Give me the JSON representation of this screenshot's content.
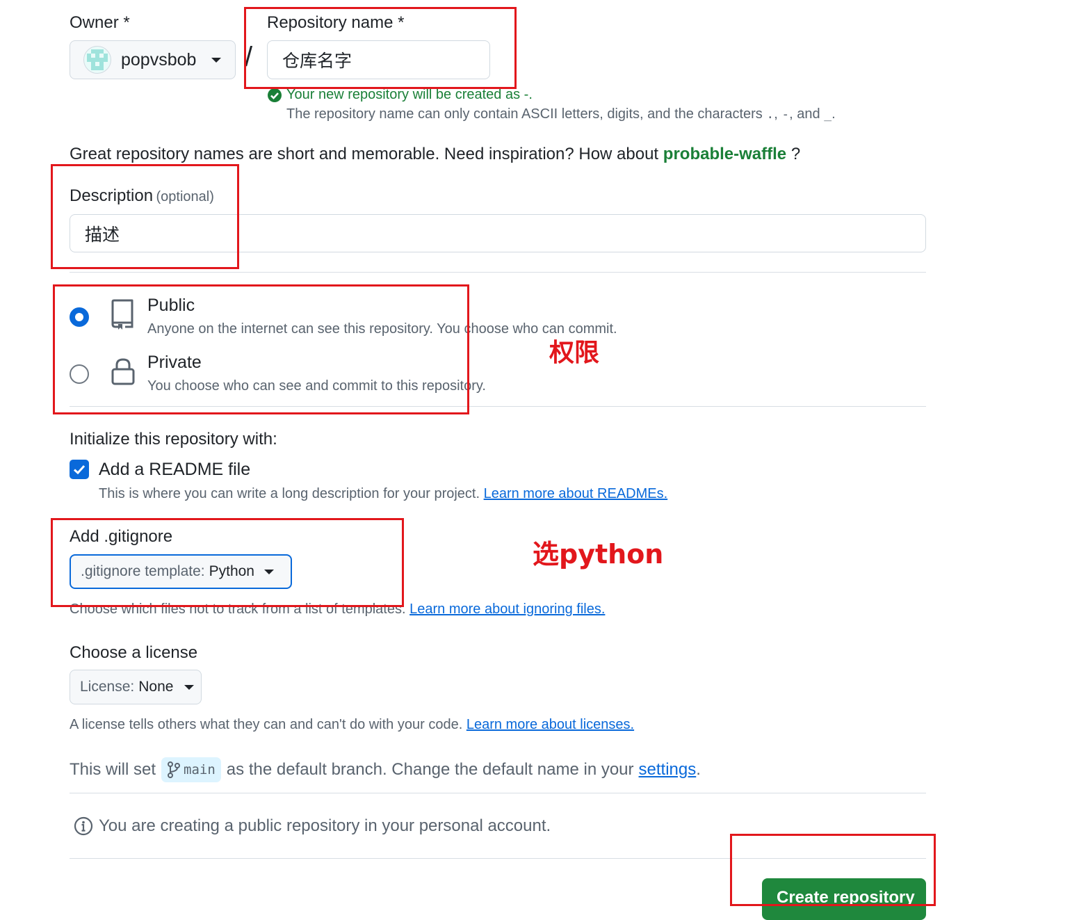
{
  "owner": {
    "label": "Owner *",
    "value": "popvsbob",
    "avatar_icon": "identicon-avatar"
  },
  "separator": "/",
  "repo_name": {
    "label": "Repository name *",
    "value": "仓库名字",
    "success_message": "Your new repository will be created as -.",
    "hint_prefix": "The repository name can only contain ASCII letters, digits, and the characters",
    "hint_chars": ".",
    "hint_comma1": ",",
    "hint_dash": "-",
    "hint_and": ", and",
    "hint_underscore": "_",
    "hint_end": "."
  },
  "inspiration": {
    "text": "Great repository names are short and memorable. Need inspiration? How about",
    "suggestion": "probable-waffle",
    "suffix": "?"
  },
  "description": {
    "label": "Description",
    "optional": "(optional)",
    "value": "描述"
  },
  "visibility": {
    "public": {
      "title": "Public",
      "desc": "Anyone on the internet can see this repository. You choose who can commit.",
      "selected": true,
      "icon": "repo-icon"
    },
    "private": {
      "title": "Private",
      "desc": "You choose who can see and commit to this repository.",
      "selected": false,
      "icon": "lock-icon"
    }
  },
  "init": {
    "heading": "Initialize this repository with:",
    "readme_label": "Add a README file",
    "readme_checked": true,
    "readme_desc": "This is where you can write a long description for your project.",
    "readme_link": "Learn more about READMEs."
  },
  "gitignore": {
    "label": "Add .gitignore",
    "button_prefix": ".gitignore template:",
    "button_value": "Python",
    "desc": "Choose which files not to track from a list of templates.",
    "link": "Learn more about ignoring files."
  },
  "license": {
    "label": "Choose a license",
    "button_prefix": "License:",
    "button_value": "None",
    "desc": "A license tells others what they can and can't do with your code.",
    "link": "Learn more about licenses."
  },
  "branch": {
    "prefix": "This will set",
    "name": "main",
    "suffix": "as the default branch. Change the default name in your",
    "link": "settings",
    "end": "."
  },
  "notice": "You are creating a public repository in your personal account.",
  "create_button": "Create repository",
  "annotations": {
    "permission": "权限",
    "choose_python": "选python"
  },
  "colors": {
    "accent": "#0969da",
    "success": "#1a7f37",
    "create_button": "#1f883d",
    "annotation_red": "#e2171c"
  }
}
